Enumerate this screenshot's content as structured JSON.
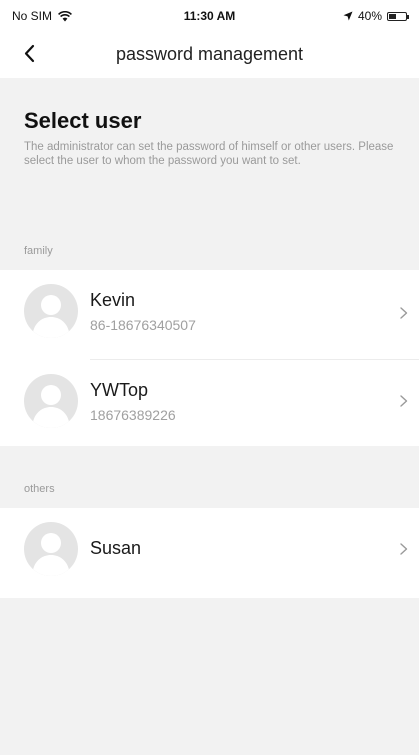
{
  "status_bar": {
    "carrier": "No SIM",
    "time": "11:30 AM",
    "battery": "40%",
    "icons": [
      "wifi-icon",
      "location-arrow-icon",
      "battery-icon"
    ]
  },
  "nav": {
    "title": "password management",
    "back_icon": "chevron-left-icon"
  },
  "header": {
    "title": "Select user",
    "description": "The administrator can set the password of himself or other users. Please select the user to whom the password you want to set."
  },
  "sections": [
    {
      "label": "family",
      "users": [
        {
          "name": "Kevin",
          "phone": "86-18676340507"
        },
        {
          "name": "YWTop",
          "phone": "18676389226"
        }
      ]
    },
    {
      "label": "others",
      "users": [
        {
          "name": "Susan"
        }
      ]
    }
  ],
  "colors": {
    "background": "#f2f2f2",
    "card": "#ffffff",
    "secondary_text": "#9a9a9a",
    "avatar": "#e4e4e4"
  }
}
